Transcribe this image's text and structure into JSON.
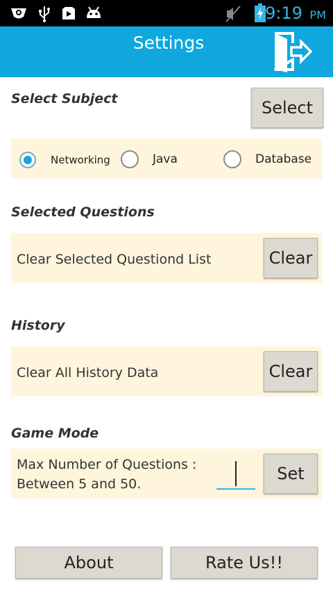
{
  "status_bar": {
    "time": "9:19",
    "ampm": "PM",
    "icons": [
      "eye-icon",
      "usb-icon",
      "play-store-icon",
      "android-icon",
      "mute-icon",
      "battery-charging-icon"
    ]
  },
  "app_bar": {
    "title": "Settings",
    "exit_icon": "exit-icon",
    "color": "#0fa7de"
  },
  "select_subject": {
    "title": "Select Subject",
    "button_label": "Select",
    "options": [
      {
        "label": "Networking",
        "checked": true
      },
      {
        "label": "Java",
        "checked": false
      },
      {
        "label": "Database",
        "checked": false
      }
    ]
  },
  "selected_questions": {
    "title": "Selected Questions",
    "text": "Clear Selected Questiond List",
    "button_label": "Clear"
  },
  "history": {
    "title": "History",
    "text": "Clear All History Data",
    "button_label": "Clear"
  },
  "game_mode": {
    "title": "Game Mode",
    "text_line1": "Max Number of Questions :",
    "text_line2": "Between 5 and 50.",
    "input_value": "",
    "button_label": "Set"
  },
  "footer": {
    "about_label": "About",
    "rate_label": "Rate Us!!"
  },
  "colors": {
    "panel_bg": "#fff5dc",
    "accent": "#33b5e5",
    "button_bg": "#dcdad0"
  }
}
